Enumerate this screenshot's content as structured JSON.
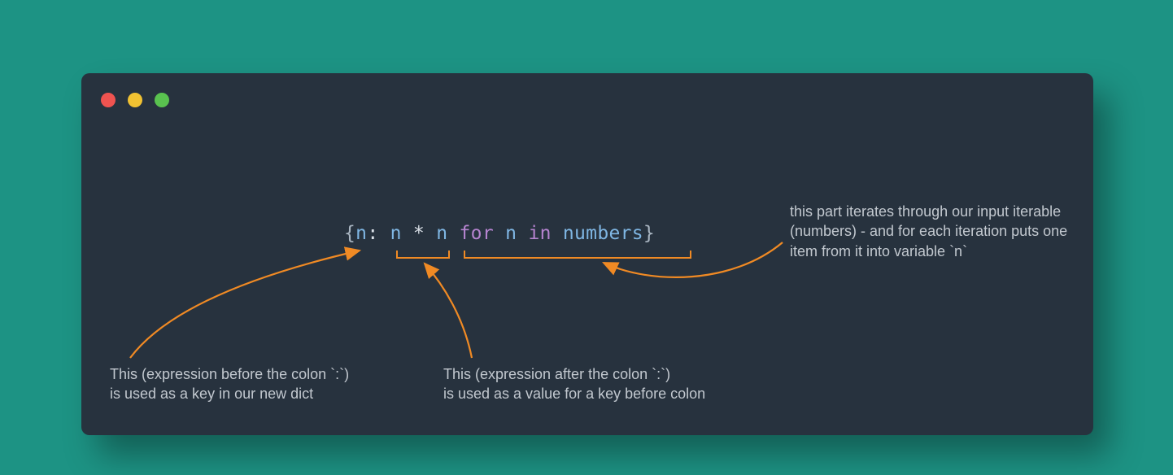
{
  "code": {
    "brace_open": "{",
    "var1": "n",
    "colon": ":",
    "space": " ",
    "var2": "n",
    "star": " * ",
    "var3": "n",
    "kw_for": " for ",
    "var4": "n",
    "kw_in": " in ",
    "var5": "numbers",
    "brace_close": "}"
  },
  "annotations": {
    "key": "This (expression before the colon `:`)\nis used as a key in our new dict",
    "value": "This (expression after the colon `:`)\nis used as a value for a key before colon",
    "iter": "this part iterates through our input iterable (numbers) - and for each iteration puts one item from it into variable `n`"
  },
  "colors": {
    "arrow": "#f08a24",
    "bg_page": "#1d9384",
    "bg_window": "#27323e"
  }
}
